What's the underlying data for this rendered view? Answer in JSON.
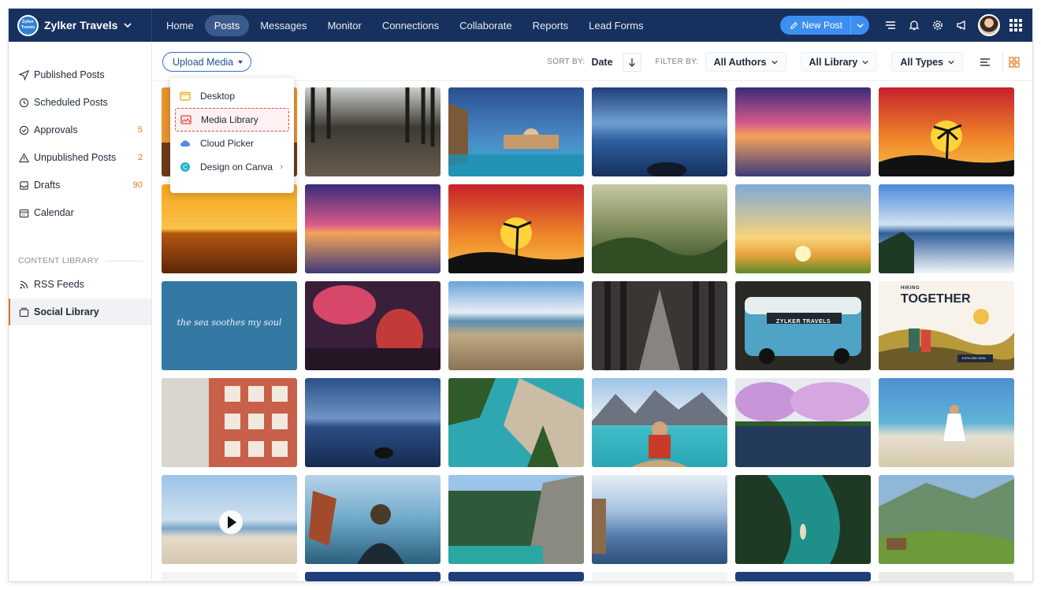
{
  "brand": {
    "name": "Zylker Travels",
    "logo_text": "Zylker Travels"
  },
  "nav": {
    "tabs": [
      {
        "label": "Home",
        "active": false
      },
      {
        "label": "Posts",
        "active": true
      },
      {
        "label": "Messages",
        "active": false
      },
      {
        "label": "Monitor",
        "active": false
      },
      {
        "label": "Connections",
        "active": false
      },
      {
        "label": "Collaborate",
        "active": false
      },
      {
        "label": "Reports",
        "active": false
      },
      {
        "label": "Lead Forms",
        "active": false
      }
    ]
  },
  "topbar": {
    "new_post_label": "New Post",
    "icons": [
      "menu-icon",
      "bell-icon",
      "gear-icon",
      "megaphone-icon",
      "avatar",
      "apps-grid-icon"
    ]
  },
  "sidebar": {
    "items": [
      {
        "label": "Published Posts",
        "icon": "send-icon",
        "count": ""
      },
      {
        "label": "Scheduled Posts",
        "icon": "clock-icon",
        "count": ""
      },
      {
        "label": "Approvals",
        "icon": "check-circle-icon",
        "count": "5"
      },
      {
        "label": "Unpublished Posts",
        "icon": "warning-icon",
        "count": "2"
      },
      {
        "label": "Drafts",
        "icon": "drafts-icon",
        "count": "90"
      },
      {
        "label": "Calendar",
        "icon": "calendar-icon",
        "count": ""
      }
    ],
    "section_title": "CONTENT LIBRARY",
    "library_items": [
      {
        "label": "RSS Feeds",
        "icon": "rss-icon",
        "active": false
      },
      {
        "label": "Social Library",
        "icon": "library-icon",
        "active": true
      }
    ]
  },
  "toolbar": {
    "upload_label": "Upload Media",
    "sort_by_label": "SORT BY:",
    "sort_value": "Date",
    "filter_by_label": "FILTER BY:",
    "filters": [
      "All Authors",
      "All Library",
      "All Types"
    ]
  },
  "upload_menu": {
    "items": [
      {
        "label": "Desktop",
        "icon": "folder-icon",
        "highlighted": false
      },
      {
        "label": "Media Library",
        "icon": "image-gallery-icon",
        "highlighted": true
      },
      {
        "label": "Cloud Picker",
        "icon": "cloud-icon",
        "highlighted": false
      },
      {
        "label": "Design on Canva",
        "icon": "canva-icon",
        "highlighted": false,
        "has_submenu": true
      }
    ]
  },
  "media_tiles": {
    "text_tile": "the sea soothes my soul",
    "van_text": "ZYLKER TRAVELS",
    "poster_kicker": "HIKING",
    "poster_title": "TOGETHER",
    "poster_button": "EXPLORE NOW"
  },
  "colors": {
    "topbar": "#17315e",
    "accent_blue": "#3c8ff0",
    "count_orange": "#e07a1f",
    "highlight_red": "#e2474b"
  }
}
